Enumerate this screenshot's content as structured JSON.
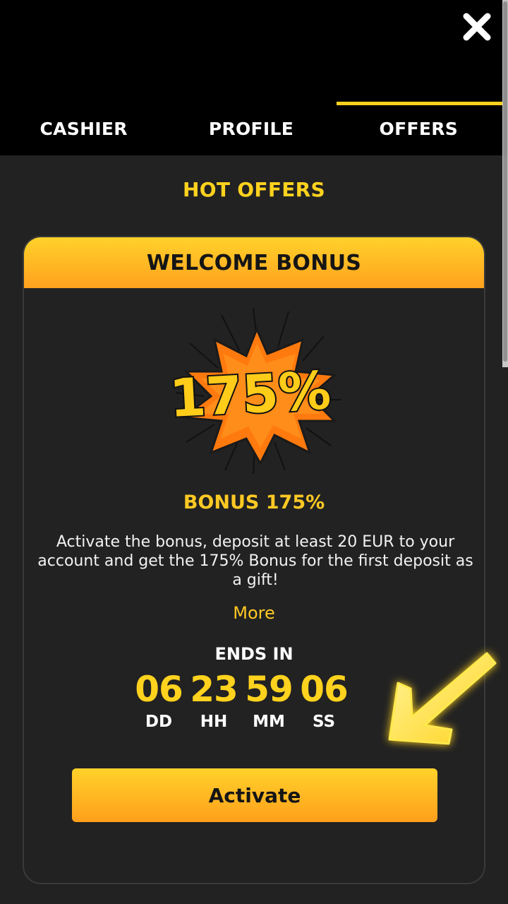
{
  "header": {
    "close_icon": "close-icon",
    "tabs": [
      {
        "label": "CASHIER",
        "active": false
      },
      {
        "label": "PROFILE",
        "active": false
      },
      {
        "label": "OFFERS",
        "active": true
      }
    ]
  },
  "section": {
    "title": "HOT OFFERS"
  },
  "offer": {
    "header": "WELCOME BONUS",
    "badge_text": "175%",
    "title": "BONUS 175%",
    "description": "Activate the bonus, deposit at least 20 EUR to your account and get the 175% Bonus for the first deposit as a gift!",
    "more_label": "More",
    "ends_in_label": "ENDS IN",
    "countdown": [
      {
        "value": "06",
        "unit": "DD"
      },
      {
        "value": "23",
        "unit": "HH"
      },
      {
        "value": "59",
        "unit": "MM"
      },
      {
        "value": "06",
        "unit": "SS"
      }
    ],
    "activate_label": "Activate"
  },
  "colors": {
    "accent": "#ffd21e",
    "accent_dark": "#ff9f1c",
    "background": "#222222",
    "header_bg": "#000000"
  }
}
